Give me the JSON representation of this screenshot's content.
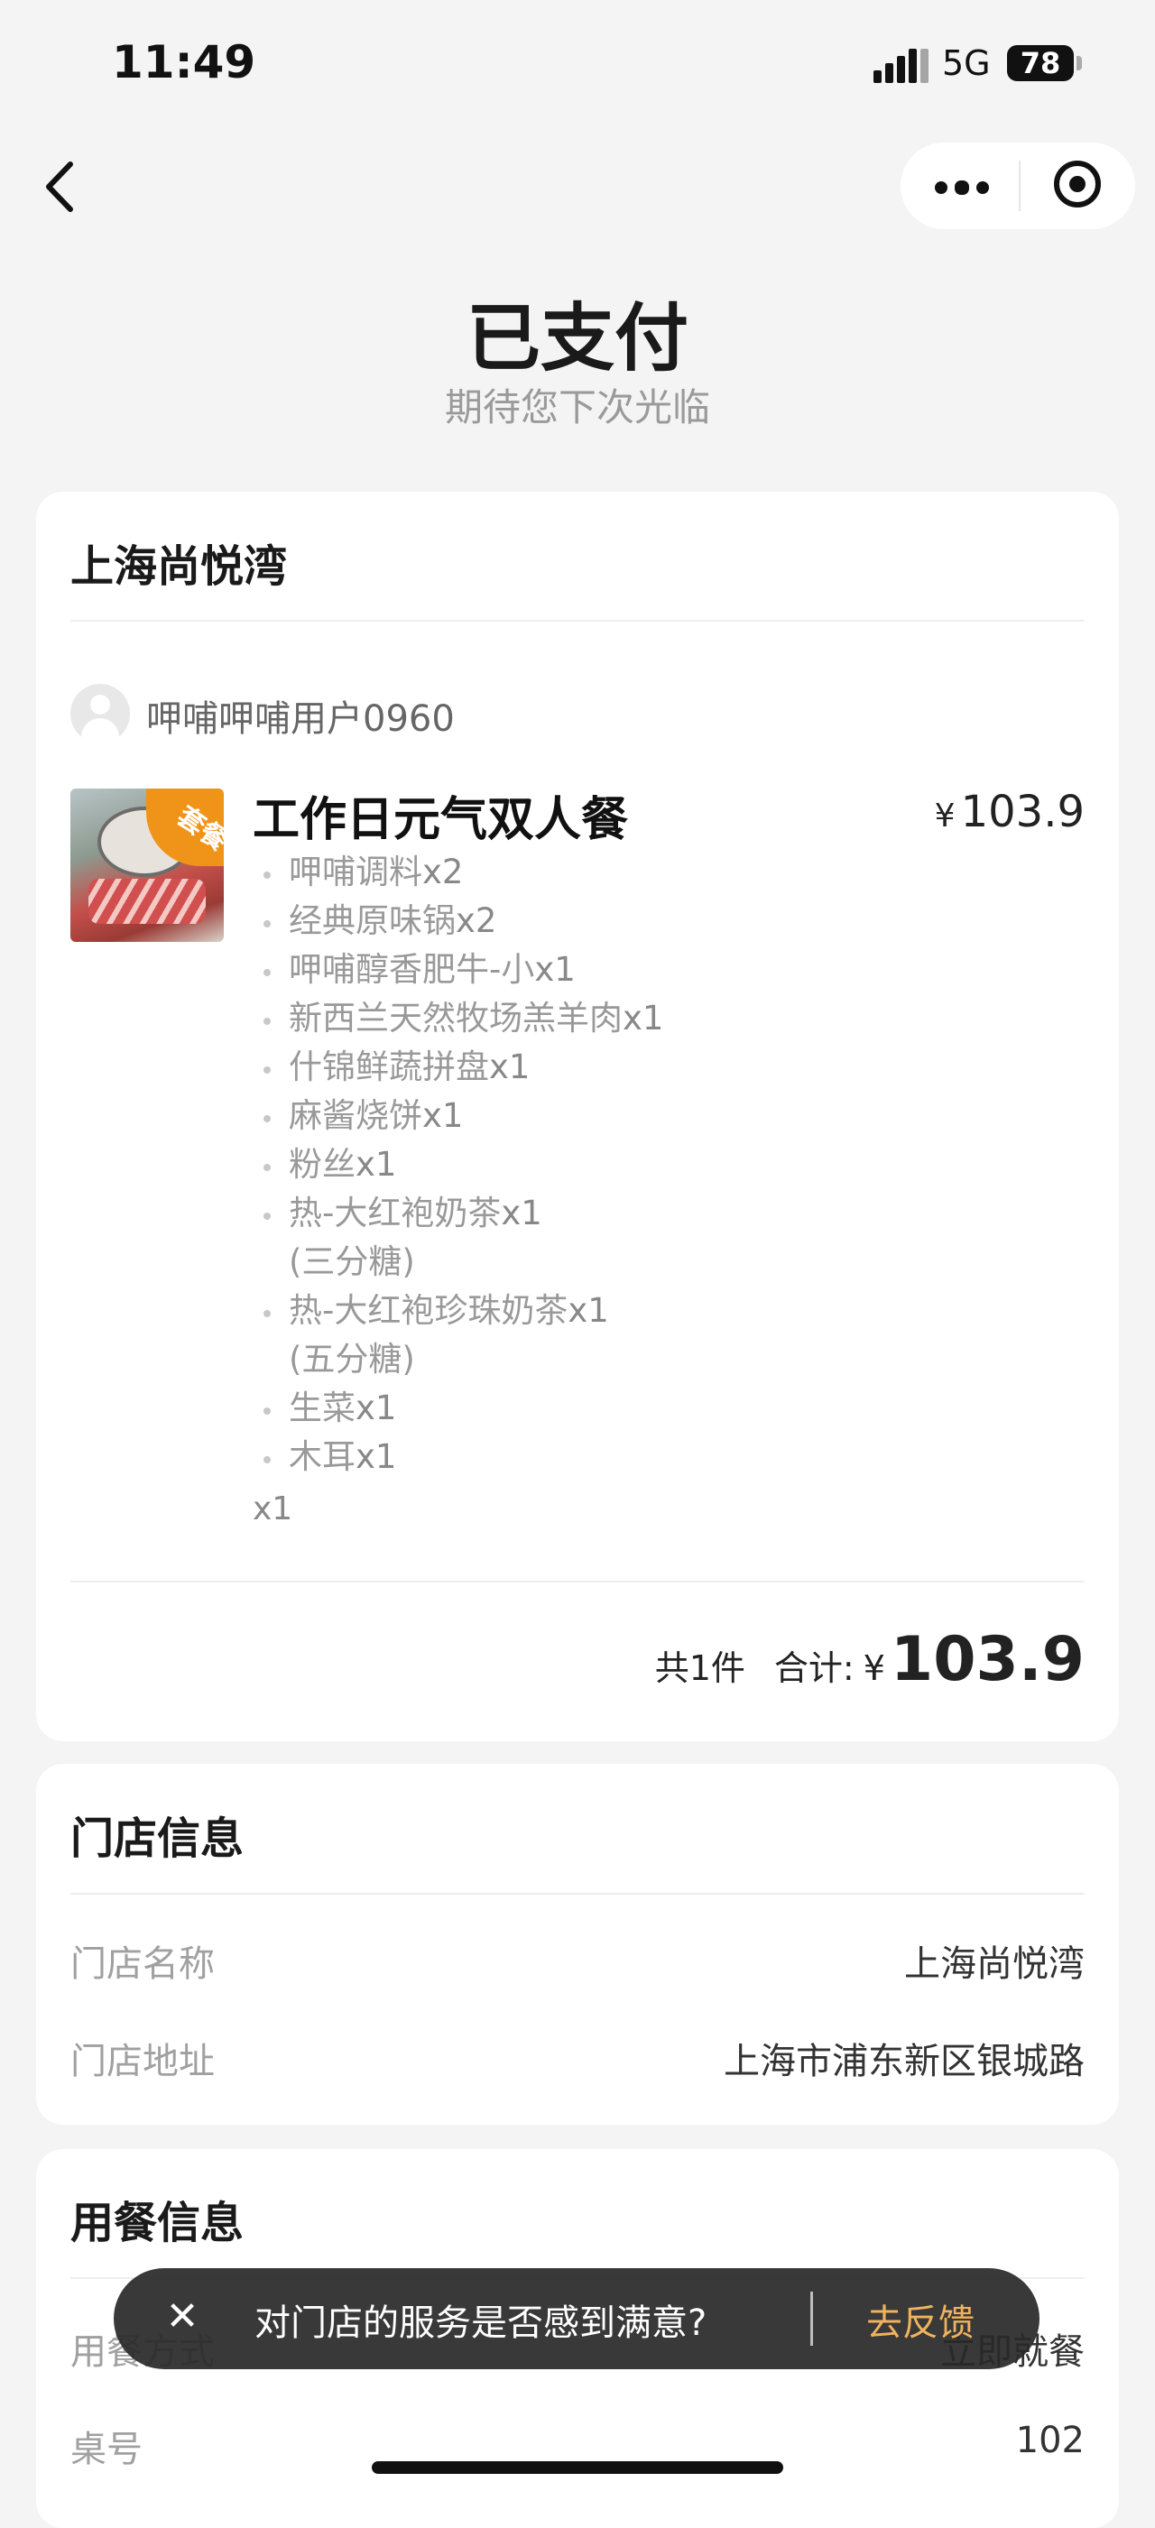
{
  "status_bar": {
    "time": "11:49",
    "network": "5G",
    "battery": "78"
  },
  "header": {
    "status": "已支付",
    "subtitle": "期待您下次光临"
  },
  "order": {
    "store_name": "上海尚悦湾",
    "user": "呷哺呷哺用户0960",
    "item": {
      "badge": "套餐",
      "name": "工作日元气双人餐",
      "price_symbol": "¥",
      "price": "103.9",
      "quantity": "x1",
      "components": [
        {
          "name": "呷哺调料",
          "qty": "x2"
        },
        {
          "name": "经典原味锅",
          "qty": "x2"
        },
        {
          "name": "呷哺醇香肥牛-小",
          "qty": "x1"
        },
        {
          "name": "新西兰天然牧场羔羊肉",
          "qty": "x1"
        },
        {
          "name": "什锦鲜蔬拼盘",
          "qty": "x1"
        },
        {
          "name": "麻酱烧饼",
          "qty": "x1"
        },
        {
          "name": "粉丝",
          "qty": "x1"
        },
        {
          "name": "热-大红袍奶茶",
          "qty": "x1",
          "note": "(三分糖)"
        },
        {
          "name": "热-大红袍珍珠奶茶",
          "qty": "x1",
          "note": "(五分糖)"
        },
        {
          "name": "生菜",
          "qty": "x1"
        },
        {
          "name": "木耳",
          "qty": "x1"
        }
      ]
    },
    "summary": {
      "count": "共1件",
      "total_label": "合计:",
      "symbol": "¥",
      "total": "103.9"
    }
  },
  "store_info": {
    "title": "门店信息",
    "name_label": "门店名称",
    "name_value": "上海尚悦湾",
    "address_label": "门店地址",
    "address_value": "上海市浦东新区银城路"
  },
  "dining_info": {
    "title": "用餐信息",
    "mode_label": "用餐方式",
    "mode_value": "立即就餐",
    "table_label": "桌号",
    "table_value": "102"
  },
  "toast": {
    "text": "对门店的服务是否感到满意?",
    "action": "去反馈"
  }
}
